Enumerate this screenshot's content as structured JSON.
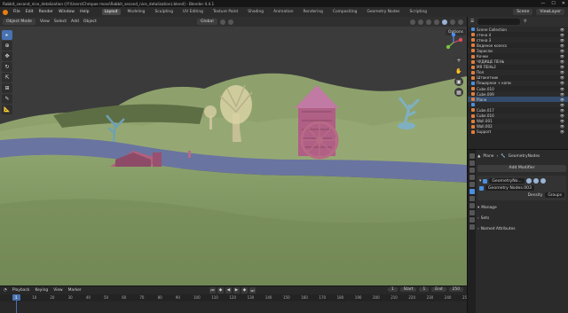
{
  "app": {
    "title": "Rabbit_second_nice_detalization (/Y:\\Users\\Chmpoe moss\\Rabbit_second_nice_detalization).blend] - Blender 4.4.1"
  },
  "menubar": {
    "items": [
      "File",
      "Edit",
      "Render",
      "Window",
      "Help"
    ],
    "workspaces": [
      "Layout",
      "Modeling",
      "Sculpting",
      "UV Editing",
      "Texture Paint",
      "Shading",
      "Animation",
      "Rendering",
      "Compositing",
      "Geometry Nodes",
      "Scripting"
    ],
    "active_workspace": "Layout",
    "scene": "Scene",
    "view_layer": "ViewLayer"
  },
  "viewport_header": {
    "mode": "Object Mode",
    "menus": [
      "View",
      "Select",
      "Add",
      "Object"
    ],
    "orientation": "Global",
    "options": "Options"
  },
  "toolbar": {
    "tools": [
      "select-box",
      "cursor",
      "move",
      "rotate",
      "scale",
      "transform",
      "annotate",
      "measure"
    ]
  },
  "timeline": {
    "menus": [
      "Playback",
      "Keying",
      "View",
      "Marker"
    ],
    "current_frame": "1",
    "start_label": "Start",
    "start_value": "1",
    "end_label": "End",
    "end_value": "250",
    "ruler": [
      "1",
      "10",
      "20",
      "30",
      "40",
      "50",
      "60",
      "70",
      "80",
      "90",
      "100",
      "110",
      "120",
      "130",
      "140",
      "150",
      "160",
      "170",
      "180",
      "190",
      "200",
      "210",
      "220",
      "230",
      "240",
      "250"
    ]
  },
  "outliner": {
    "items": [
      {
        "label": "Scene Collection",
        "type": "col"
      },
      {
        "label": "стена 4",
        "type": "obj"
      },
      {
        "label": "стена 3",
        "type": "obj"
      },
      {
        "label": "Водяное колесо",
        "type": "obj"
      },
      {
        "label": "Заросли",
        "type": "obj"
      },
      {
        "label": "Кочки",
        "type": "obj"
      },
      {
        "label": "ЧУДИЩЕ ПЕНЬ",
        "type": "obj"
      },
      {
        "label": "МЯ ПЕНЬ2",
        "type": "obj"
      },
      {
        "label": "Пол",
        "type": "obj"
      },
      {
        "label": "Штакетник",
        "type": "obj"
      },
      {
        "label": "Пещерное + копи",
        "type": "col"
      },
      {
        "label": "Cube.010",
        "type": "obj"
      },
      {
        "label": "Cube.009",
        "type": "obj"
      },
      {
        "label": "Plane",
        "type": "obj",
        "selected": true
      },
      {
        "label": "",
        "type": "col"
      },
      {
        "label": "Cube.017",
        "type": "obj"
      },
      {
        "label": "Cube.016",
        "type": "obj"
      },
      {
        "label": "Wall.001",
        "type": "obj"
      },
      {
        "label": "Wall.002",
        "type": "obj"
      },
      {
        "label": "Support",
        "type": "obj"
      }
    ]
  },
  "properties": {
    "object_name": "Plane",
    "modifier_tab": "GeometryNodes",
    "add_modifier": "Add Modifier",
    "modifier_name": "GeometryNo...",
    "node_group": "Geometry Nodes.003",
    "density_label": "Density",
    "density_value": "Groups",
    "manage": "Manage",
    "sets": "Sets",
    "named_attributes": "Named Attributes"
  },
  "colors": {
    "accent": "#4772b3",
    "ground": "#8aa06a",
    "river": "#6a74a0",
    "sky": "#3a3a3a"
  }
}
